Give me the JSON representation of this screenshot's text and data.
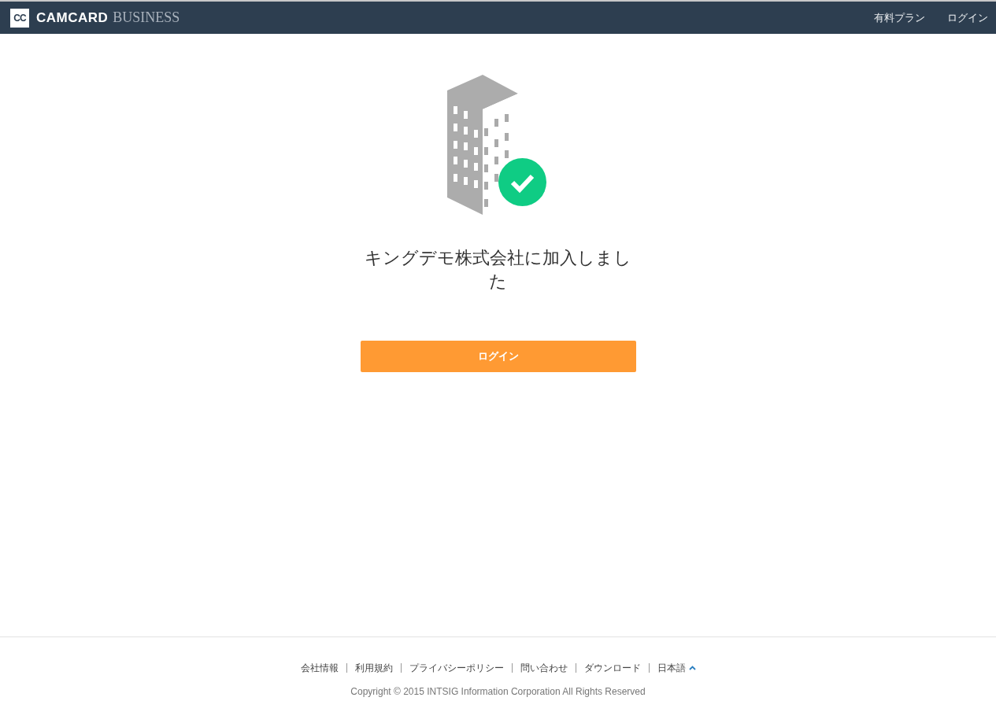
{
  "header": {
    "logo_mark": "CC",
    "brand": "CAMCARD",
    "brand_suffix": "BUSINESS",
    "nav": [
      "有料プラン",
      "ログイン"
    ]
  },
  "main": {
    "message": "キングデモ株式会社に加入しました",
    "button": "ログイン"
  },
  "footer": {
    "links": [
      "会社情報",
      "利用規約",
      "プライバシーポリシー",
      "問い合わせ",
      "ダウンロード"
    ],
    "language": "日本語",
    "copyright": "Copyright © 2015 INTSIG Information Corporation All Rights Reserved"
  }
}
